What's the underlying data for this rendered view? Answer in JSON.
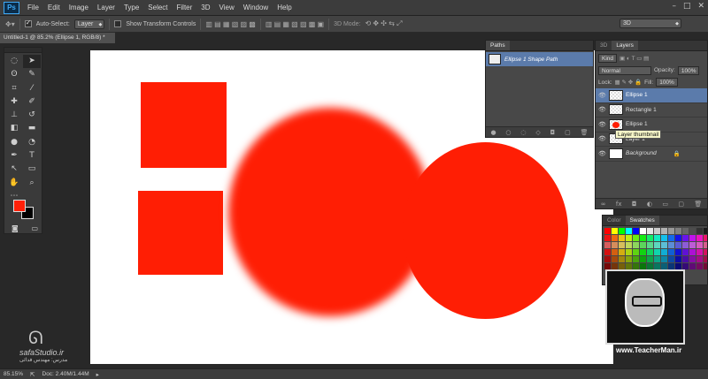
{
  "app": {
    "logo": "Ps"
  },
  "menu": [
    "File",
    "Edit",
    "Image",
    "Layer",
    "Type",
    "Select",
    "Filter",
    "3D",
    "View",
    "Window",
    "Help"
  ],
  "window_controls": [
    "–",
    "□",
    "✕"
  ],
  "options_bar": {
    "auto_select_label": "Auto-Select:",
    "auto_select_value": "Layer",
    "show_transform_label": "Show Transform Controls",
    "mode_label": "3D Mode:",
    "workspace_value": "3D"
  },
  "document": {
    "tab_title": "Untitled-1 @ 85.2% (Ellipse 1, RGB/8) *"
  },
  "colors": {
    "shape_red": "#ff1e04",
    "foreground": "#ff2008",
    "background": "#000000",
    "selected_row": "#5b7bab"
  },
  "paths_panel": {
    "tab": "Paths",
    "path_name": "Ellipse 1 Shape Path"
  },
  "layers_panel": {
    "tabs": [
      "3D",
      "Layers"
    ],
    "filter_value": "Kind",
    "blend_mode": "Normal",
    "opacity_label": "Opacity:",
    "opacity_value": "100%",
    "lock_label": "Lock:",
    "fill_label": "Fill:",
    "fill_value": "100%",
    "tooltip": "Layer thumbnail",
    "layers": [
      {
        "name": "Ellipse 1",
        "selected": true
      },
      {
        "name": "Rectangle 1",
        "selected": false
      },
      {
        "name": "Ellipse 1",
        "selected": false
      },
      {
        "name": "Layer 1",
        "selected": false
      },
      {
        "name": "Background",
        "selected": false
      }
    ],
    "footer_icons": [
      "link-icon",
      "fx-icon",
      "mask-icon",
      "adjustment-icon",
      "group-icon",
      "new-layer-icon",
      "trash-icon"
    ]
  },
  "swatches_panel": {
    "tabs": [
      "Color",
      "Swatches"
    ]
  },
  "watermark": {
    "site": "www.TeacherMan.ir",
    "studio": "safaStudio.ir",
    "studio_sub": "مدرس: مهندس فدائی"
  },
  "status": {
    "zoom": "85.15%",
    "doc": "Doc: 2.40M/1.44M"
  }
}
